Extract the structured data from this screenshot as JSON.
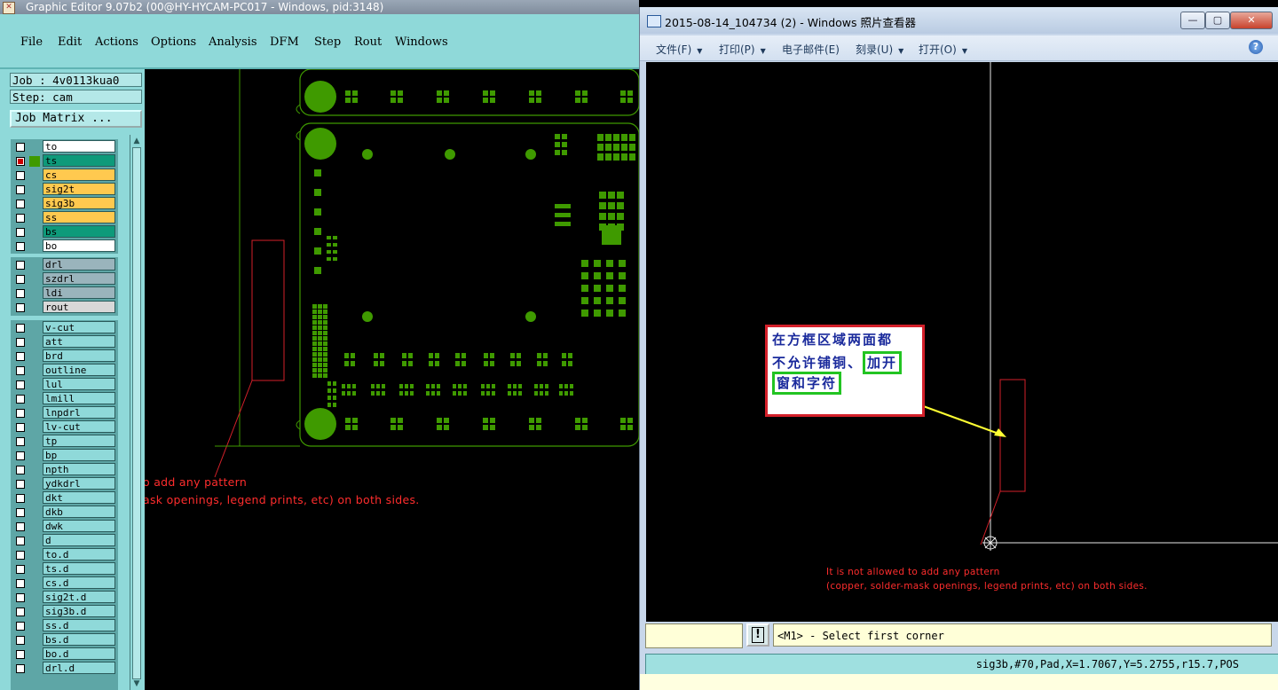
{
  "colors": {
    "pcb_green": "#3f9a00",
    "menu_bg": "#8fd9d9",
    "ts_layer": "#0e9a7a",
    "signal_layer": "#ffc94f",
    "drill_layer": "#9ab4bc",
    "callout_border": "#d4202a",
    "callout_highlight": "#22c422",
    "arrow": "#ffff33"
  },
  "ge": {
    "title": "Graphic Editor 9.07b2 (00@HY-HYCAM-PC017 - Windows, pid:3148)",
    "app_icon": "x-window-icon",
    "menu": [
      "File",
      "Edit",
      "Actions",
      "Options",
      "Analysis",
      "DFM",
      "Step",
      "Rout",
      "Windows"
    ],
    "job_label": "Job : 4v0113kua0",
    "step_label": "Step: cam",
    "job_matrix_label": "Job Matrix ...",
    "layers_board": [
      {
        "name": "to",
        "bg": "#ffffff",
        "swatch": "",
        "checked": false
      },
      {
        "name": "ts",
        "bg": "#0e9a7a",
        "swatch": "#3f9a00",
        "checked": true
      },
      {
        "name": "cs",
        "bg": "#ffc94f",
        "swatch": "",
        "checked": false
      },
      {
        "name": "sig2t",
        "bg": "#ffc94f",
        "swatch": "",
        "checked": false
      },
      {
        "name": "sig3b",
        "bg": "#ffc94f",
        "swatch": "",
        "checked": false
      },
      {
        "name": "ss",
        "bg": "#ffc94f",
        "swatch": "",
        "checked": false
      },
      {
        "name": "bs",
        "bg": "#0e9a7a",
        "swatch": "",
        "checked": false
      },
      {
        "name": "bo",
        "bg": "#ffffff",
        "swatch": "",
        "checked": false
      }
    ],
    "layers_drill": [
      {
        "name": "drl",
        "bg": "#9ab4bc"
      },
      {
        "name": "szdrl",
        "bg": "#9ab4bc"
      },
      {
        "name": "ldi",
        "bg": "#9ab4bc"
      },
      {
        "name": "rout",
        "bg": "#d8d8d8"
      }
    ],
    "layers_misc": [
      "v-cut",
      "att",
      "brd",
      "outline",
      "lul",
      "lmill",
      "lnpdrl",
      "lv-cut",
      "tp",
      "bp",
      "npth",
      "ydkdrl",
      "dkt",
      "dkb",
      "dwk",
      "d",
      "to.d",
      "ts.d",
      "cs.d",
      "sig2t.d",
      "sig3b.d",
      "ss.d",
      "bs.d",
      "bo.d",
      "drl.d"
    ],
    "canvas_caption_1": "o add any pattern",
    "canvas_caption_2": "ask openings, legend prints, etc) on both sides."
  },
  "pv": {
    "title": "2015-08-14_104734 (2) - Windows 照片查看器",
    "window_buttons": [
      "minimize-button",
      "maximize-button",
      "close-button"
    ],
    "menu": [
      {
        "label": "文件(F)",
        "dropdown": true
      },
      {
        "label": "打印(P)",
        "dropdown": true
      },
      {
        "label": "电子邮件(E)",
        "dropdown": false
      },
      {
        "label": "刻录(U)",
        "dropdown": true
      },
      {
        "label": "打开(O)",
        "dropdown": true
      }
    ],
    "callout": {
      "line1": "在方框区域两面都",
      "line2_plain": "不允许铺铜、",
      "line2_highlight": "加开",
      "line3_highlight": "窗和字符"
    },
    "caption_1": "It is not allowed to add any pattern",
    "caption_2": "(copper, solder-mask openings, legend prints, etc) on both sides.",
    "alert_symbol": "!",
    "prompt": "<M1> - Select first corner",
    "status": "sig3b,#70,Pad,X=1.7067,Y=5.2755,r15.7,POS"
  }
}
